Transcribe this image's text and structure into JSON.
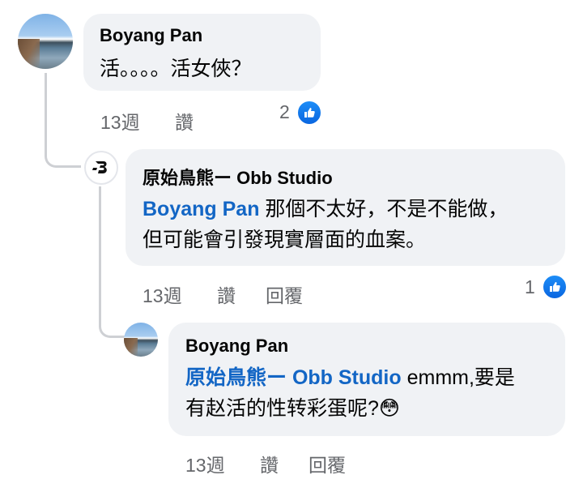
{
  "comment1": {
    "author": "Boyang Pan",
    "text": "活。。。。活女俠？",
    "time": "13週",
    "like_action": "讚",
    "reaction_count": "2"
  },
  "reply1": {
    "author": "原始鳥熊ー Obb Studio",
    "mention": "Boyang Pan",
    "text_line1": " 那個不太好，不是不能做，",
    "text_line2": "但可能會引發現實層面的血案。",
    "time": "13週",
    "like_action": "讚",
    "reply_action": "回覆",
    "reaction_count": "1"
  },
  "reply2": {
    "author": "Boyang Pan",
    "mention": "原始鳥熊ー Obb Studio",
    "text_line1": " emmm,要是",
    "text_line2": "有赵活的性转彩蛋呢?",
    "emoji": "😳",
    "time": "13週",
    "like_action": "讚",
    "reply_action": "回覆"
  },
  "icons": {
    "avatar": "boyang-avatar",
    "page_avatar": "obb-logo",
    "reaction": "like-reaction-icon",
    "emoji": "flushed-face-emoji"
  },
  "colors": {
    "bubble": "#f0f2f5",
    "mention": "#1366c5",
    "meta": "#65676b",
    "like": "#0a66e0"
  }
}
